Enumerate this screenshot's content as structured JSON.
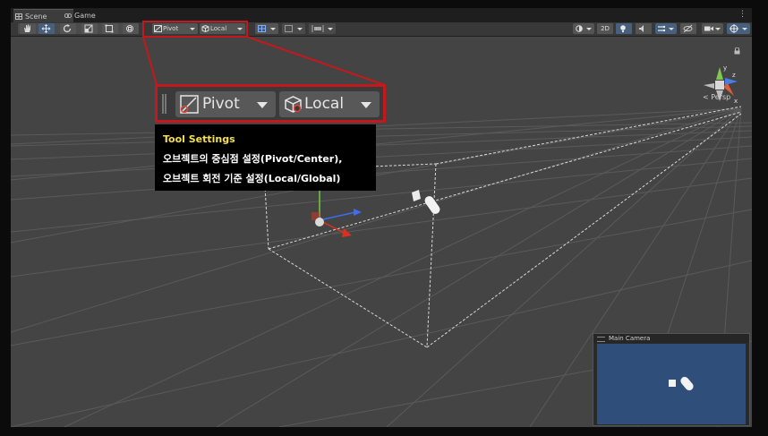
{
  "tabs": [
    {
      "label": "Scene",
      "icon": "scene-grid-icon",
      "active": true
    },
    {
      "label": "Game",
      "icon": "game-controller-icon",
      "active": false
    }
  ],
  "toolbar": {
    "tools": [
      "hand-tool-icon",
      "move-tool-icon",
      "rotate-tool-icon",
      "scale-tool-icon",
      "rect-tool-icon",
      "transform-tool-icon"
    ],
    "pivot_label": "Pivot",
    "local_label": "Local",
    "right_buttons": [
      "shading-mode-icon",
      "2d-toggle",
      "lighting-icon",
      "audio-icon",
      "effects-icon",
      "hidden-objects-icon",
      "camera-icon",
      "gizmos-icon"
    ],
    "twod_label": "2D"
  },
  "zoom": {
    "pivot_label": "Pivot",
    "local_label": "Local"
  },
  "caption": {
    "title": "Tool Settings",
    "line1": "오브젝트의 중심점 설정(Pivot/Center),",
    "line2": "오브젝트 회전 기준 설정(Local/Global)"
  },
  "gizmo": {
    "projection": "< Persp",
    "axis_y": "y",
    "axis_z": "z",
    "axis_x": "x"
  },
  "camera_preview": {
    "title": "Main Camera"
  },
  "colors": {
    "highlight": "#c5181c",
    "caption_title": "#f5e04a",
    "camera_bg": "#2f4f7a",
    "viewport_bg": "#444444"
  }
}
